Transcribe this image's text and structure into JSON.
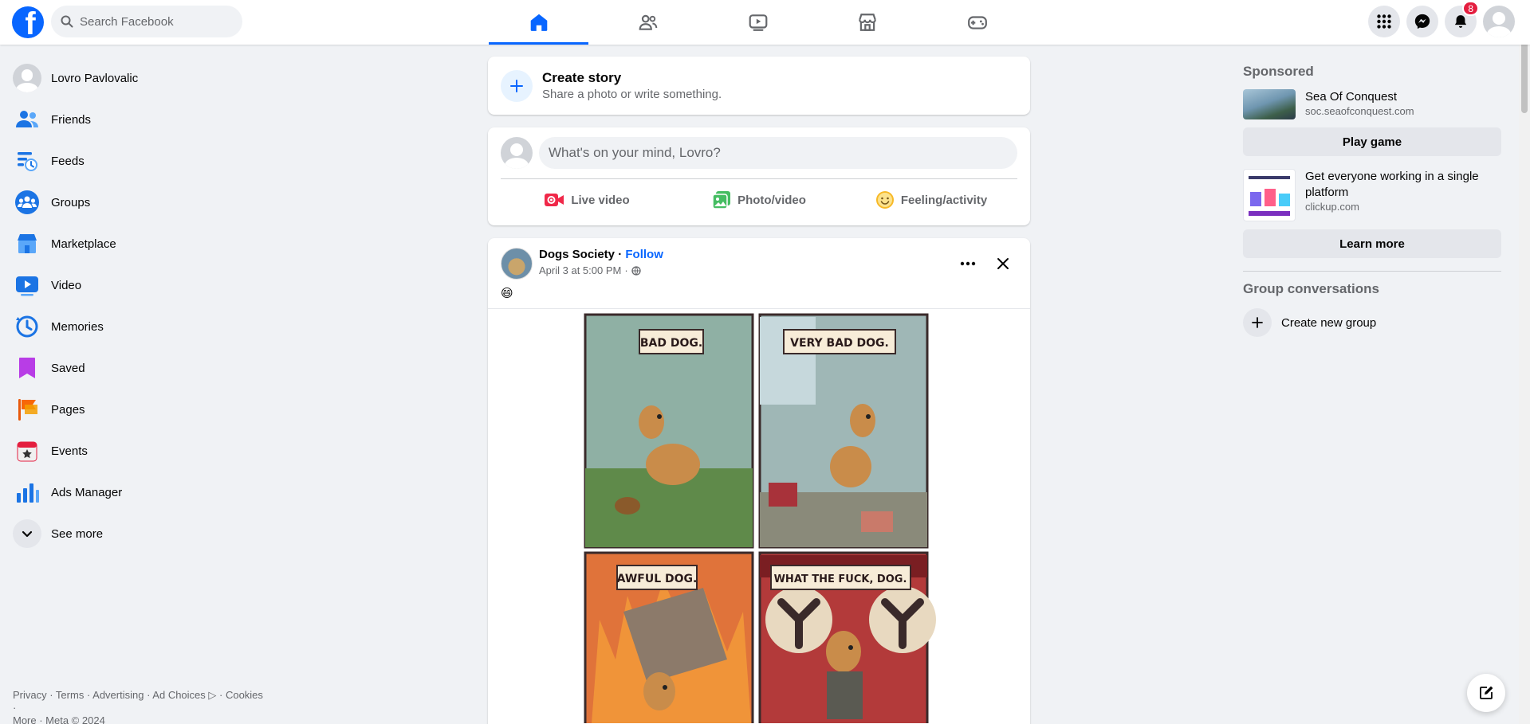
{
  "topbar": {
    "search_placeholder": "Search Facebook",
    "notifications_count": "8",
    "nav_tabs": [
      "Home",
      "Friends",
      "Video",
      "Marketplace",
      "Gaming"
    ],
    "active_tab": "Home"
  },
  "sidebar": {
    "items": [
      {
        "label": "Lovro Pavlovalic",
        "icon": "profile-avatar"
      },
      {
        "label": "Friends",
        "icon": "friends-icon"
      },
      {
        "label": "Feeds",
        "icon": "feeds-icon"
      },
      {
        "label": "Groups",
        "icon": "groups-icon"
      },
      {
        "label": "Marketplace",
        "icon": "marketplace-icon"
      },
      {
        "label": "Video",
        "icon": "video-icon"
      },
      {
        "label": "Memories",
        "icon": "memories-icon"
      },
      {
        "label": "Saved",
        "icon": "saved-icon"
      },
      {
        "label": "Pages",
        "icon": "pages-icon"
      },
      {
        "label": "Events",
        "icon": "events-icon"
      },
      {
        "label": "Ads Manager",
        "icon": "ads-manager-icon"
      },
      {
        "label": "See more",
        "icon": "chevron-down-icon"
      }
    ],
    "footer_line1": "Privacy · Terms · Advertising · Ad Choices ▷ · Cookies ·",
    "footer_line2": "More · Meta © 2024"
  },
  "feed": {
    "create_story": {
      "title": "Create story",
      "subtitle": "Share a photo or write something."
    },
    "composer": {
      "placeholder": "What's on your mind, Lovro?",
      "actions": [
        "Live video",
        "Photo/video",
        "Feeling/activity"
      ]
    },
    "post": {
      "author": "Dogs Society",
      "separator": " · ",
      "follow_label": "Follow",
      "timestamp": "April 3 at 5:00 PM",
      "meta_separator": "·",
      "text": "😄",
      "comic_panels": [
        "BAD DOG.",
        "VERY BAD DOG.",
        "AWFUL DOG.",
        "WHAT THE FUCK, DOG."
      ]
    }
  },
  "rightcol": {
    "sponsored_title": "Sponsored",
    "ads": [
      {
        "title": "Sea Of Conquest",
        "domain": "soc.seaofconquest.com",
        "button": "Play game"
      },
      {
        "title": "Get everyone working in a single platform",
        "domain": "clickup.com",
        "button": "Learn more"
      }
    ],
    "group_conversations_title": "Group conversations",
    "create_group_label": "Create new group"
  },
  "colors": {
    "brand": "#0866ff",
    "background": "#f0f2f5",
    "badge": "#e41e3f"
  }
}
